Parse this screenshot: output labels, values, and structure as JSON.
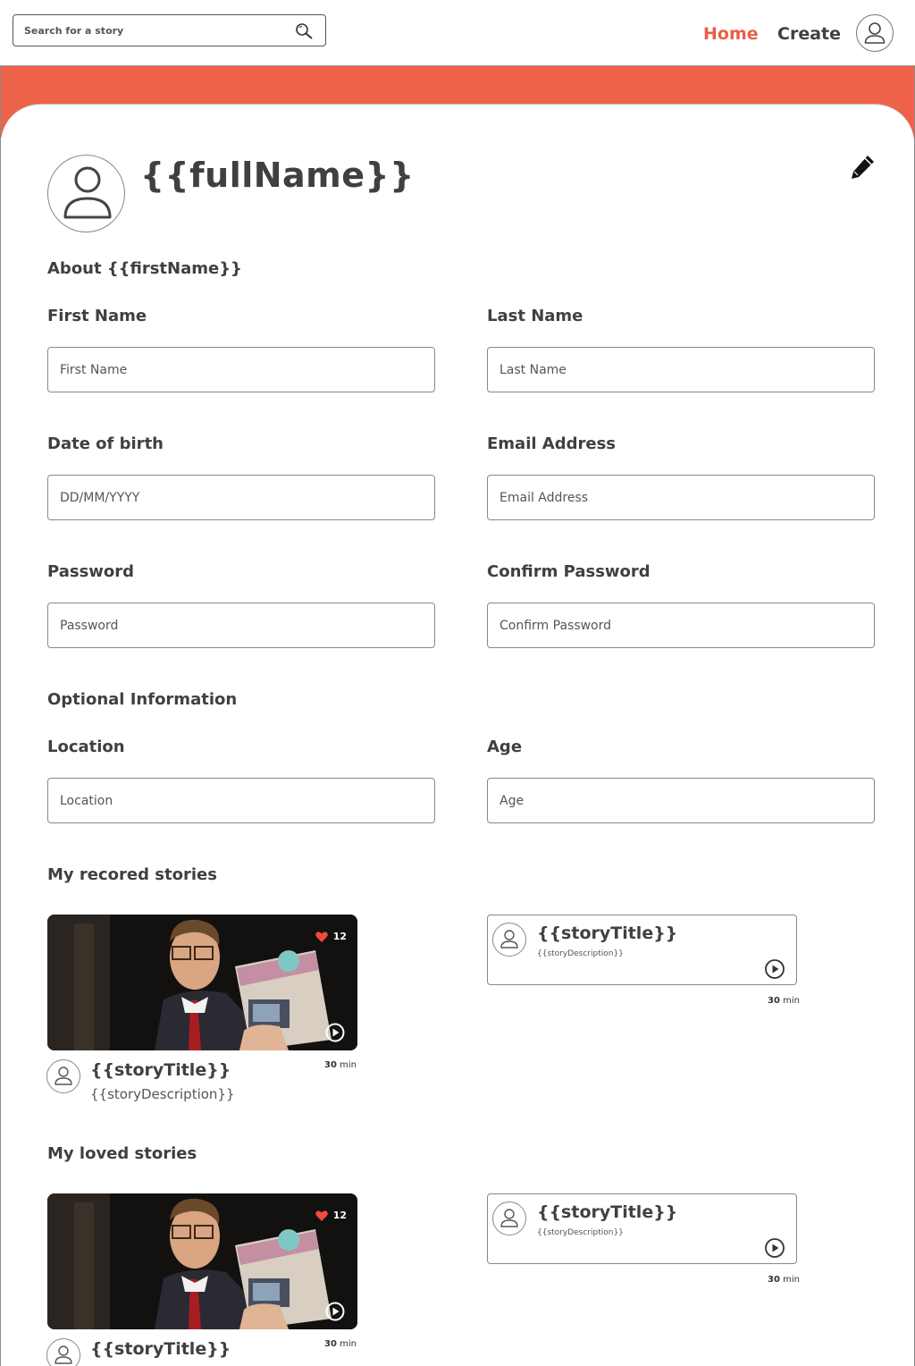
{
  "header": {
    "search_placeholder": "Search for a story",
    "nav_home": "Home",
    "nav_create": "Create",
    "accent_color": "#ea5f45"
  },
  "profile": {
    "full_name": "{{fullName}}",
    "about_heading": "About {{firstName}}"
  },
  "form": {
    "first_name_label": "First Name",
    "first_name_placeholder": "First Name",
    "last_name_label": "Last Name",
    "last_name_placeholder": "Last Name",
    "dob_label": "Date of birth",
    "dob_placeholder": "DD/MM/YYYY",
    "email_label": "Email Address",
    "email_placeholder": "Email Address",
    "password_label": "Password",
    "password_placeholder": "Password",
    "confirm_label": "Confirm Password",
    "confirm_placeholder": "Confirm Password",
    "optional_heading": "Optional Information",
    "location_label": "Location",
    "location_placeholder": "Location",
    "age_label": "Age",
    "age_placeholder": "Age"
  },
  "recorded": {
    "heading": "My recored stories",
    "card": {
      "likes": "12",
      "duration_num": "30",
      "duration_unit": "min",
      "title": "{{storyTitle}}",
      "description": "{{storyDescription}}"
    },
    "box": {
      "title": "{{storyTitle}}",
      "description": "{{storyDescription}}",
      "duration_num": "30",
      "duration_unit": "min"
    }
  },
  "loved": {
    "heading": "My loved stories",
    "card": {
      "likes": "12",
      "duration_num": "30",
      "duration_unit": "min",
      "title": "{{storyTitle}}"
    },
    "box": {
      "title": "{{storyTitle}}",
      "description": "{{storyDescription}}",
      "duration_num": "30",
      "duration_unit": "min"
    }
  },
  "icons": {
    "search": "search-icon",
    "user": "user-icon",
    "edit": "pencil-icon",
    "heart": "heart-icon",
    "play": "play-icon"
  }
}
